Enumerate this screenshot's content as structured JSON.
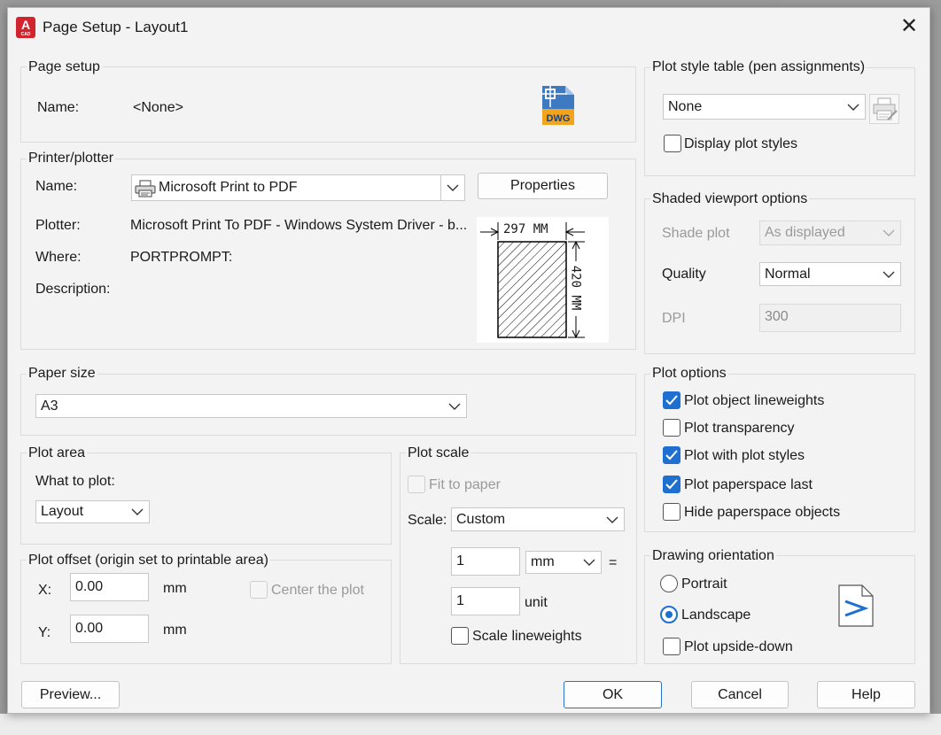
{
  "window": {
    "title": "Page Setup - Layout1",
    "app_icon_letter": "A",
    "app_icon_sub": "CAD"
  },
  "page_setup": {
    "legend": "Page setup",
    "name_label": "Name:",
    "name_value": "<None>",
    "file_icon": "dwg-file-icon",
    "file_icon_text": "DWG"
  },
  "printer": {
    "legend": "Printer/plotter",
    "name_label": "Name:",
    "name_value": "Microsoft Print to PDF",
    "properties_label": "Properties",
    "plotter_label": "Plotter:",
    "plotter_value": "Microsoft Print To PDF - Windows System Driver - b...",
    "where_label": "Where:",
    "where_value": "PORTPROMPT:",
    "description_label": "Description:",
    "preview_width": "297 MM",
    "preview_height": "420 MM"
  },
  "paper_size": {
    "legend": "Paper size",
    "value": "A3"
  },
  "plot_area": {
    "legend": "Plot area",
    "what_label": "What to plot:",
    "what_value": "Layout"
  },
  "plot_offset": {
    "legend": "Plot offset (origin set to printable area)",
    "x_label": "X:",
    "x_value": "0.00",
    "x_unit": "mm",
    "y_label": "Y:",
    "y_value": "0.00",
    "y_unit": "mm",
    "center_label": "Center the plot",
    "center_checked": false
  },
  "plot_scale": {
    "legend": "Plot scale",
    "fit_label": "Fit to paper",
    "scale_label": "Scale:",
    "scale_value": "Custom",
    "value1": "1",
    "unit1": "mm",
    "equals": "=",
    "value2": "1",
    "unit2": "unit",
    "lineweights_label": "Scale lineweights"
  },
  "plot_style_table": {
    "legend": "Plot style table (pen assignments)",
    "value": "None",
    "display_label": "Display plot styles",
    "display_checked": false
  },
  "shaded_viewport": {
    "legend": "Shaded viewport options",
    "shade_label": "Shade plot",
    "shade_value": "As displayed",
    "quality_label": "Quality",
    "quality_value": "Normal",
    "dpi_label": "DPI",
    "dpi_value": "300"
  },
  "plot_options": {
    "legend": "Plot options",
    "items": [
      {
        "label": "Plot object lineweights",
        "checked": true
      },
      {
        "label": "Plot transparency",
        "checked": false
      },
      {
        "label": "Plot with plot styles",
        "checked": true
      },
      {
        "label": "Plot paperspace last",
        "checked": true
      },
      {
        "label": "Hide paperspace objects",
        "checked": false
      }
    ]
  },
  "orientation": {
    "legend": "Drawing orientation",
    "portrait_label": "Portrait",
    "landscape_label": "Landscape",
    "selected": "Landscape",
    "upside_down_label": "Plot upside-down"
  },
  "buttons": {
    "preview": "Preview...",
    "ok": "OK",
    "cancel": "Cancel",
    "help": "Help"
  },
  "colors": {
    "accent": "#1f6fd0",
    "dialog_bg": "#f3f3f3",
    "app_icon_red": "#d1242f"
  }
}
